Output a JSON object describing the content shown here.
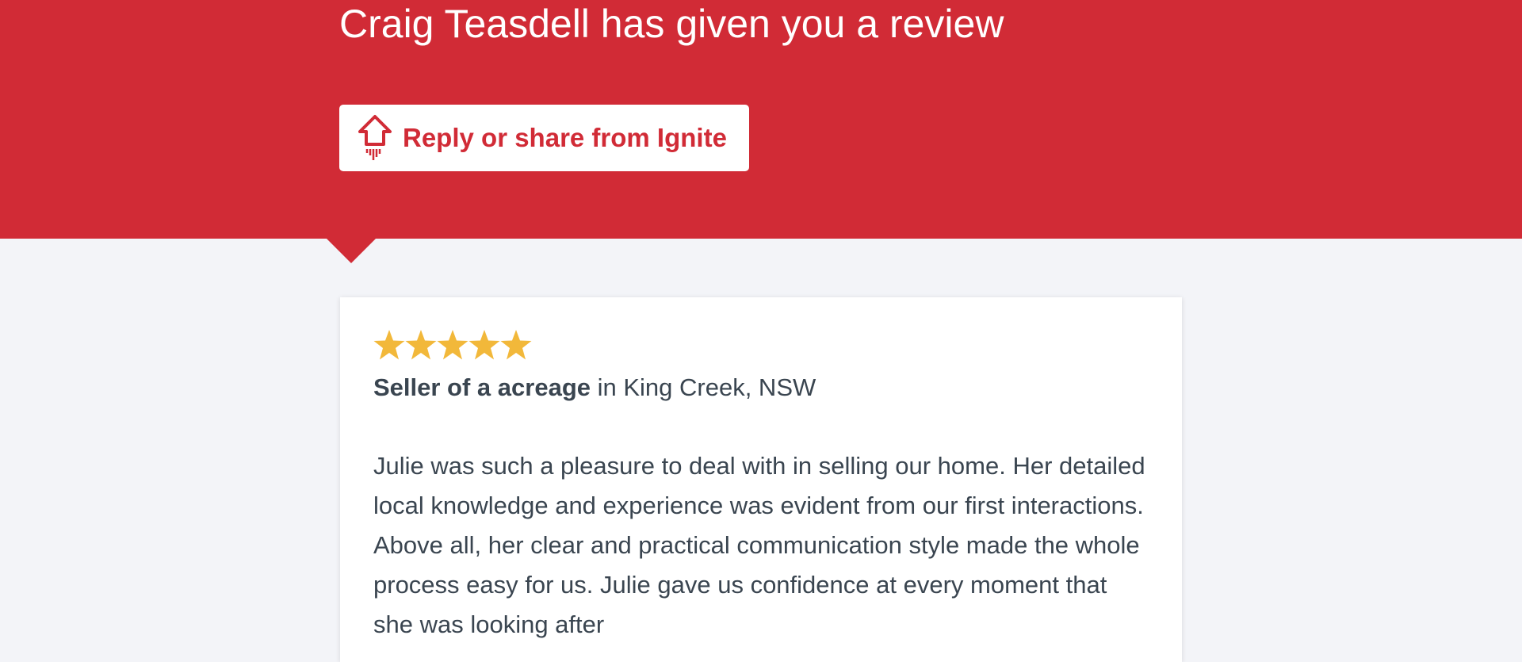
{
  "header": {
    "title": "Craig Teasdell has given you a review",
    "reply_button_label": "Reply or share from Ignite",
    "reply_button_icon": "house-rocket-icon"
  },
  "colors": {
    "brand_red": "#d12b36",
    "star_gold": "#f2b83a",
    "text_dark": "#3a4550",
    "page_bg": "#f3f4f8"
  },
  "review": {
    "rating": 5,
    "rating_max": 5,
    "role": "Seller of a acreage",
    "location": " in King Creek, NSW",
    "body": "Julie was such a pleasure to deal with in selling our home. Her detailed local knowledge and experience was evident from our first interactions. Above all, her clear and practical communication style made the whole process easy for us. Julie gave us confidence at every moment that she was looking after"
  }
}
